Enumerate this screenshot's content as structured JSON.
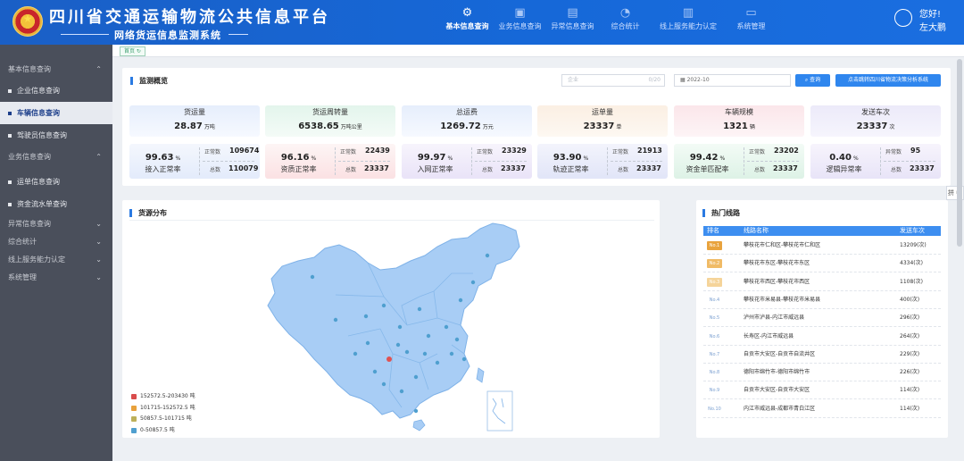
{
  "header": {
    "title": "四川省交通运输物流公共信息平台",
    "subtitle": "网络货运信息监测系统",
    "user_greeting": "您好!",
    "user_name": "左大鹏",
    "nav": [
      {
        "label": "基本信息查询",
        "icon": "grid-icon"
      },
      {
        "label": "业务信息查询",
        "icon": "box-icon"
      },
      {
        "label": "异常信息查询",
        "icon": "document-icon"
      },
      {
        "label": "综合统计",
        "icon": "pie-icon"
      },
      {
        "label": "线上服务能力认定",
        "icon": "building-icon"
      },
      {
        "label": "系统管理",
        "icon": "monitor-icon"
      }
    ]
  },
  "sidebar": {
    "groups": [
      {
        "label": "基本信息查询",
        "expanded": true,
        "items": [
          "企业信息查询",
          "车辆信息查询",
          "驾驶员信息查询"
        ]
      },
      {
        "label": "业务信息查询",
        "expanded": true,
        "items": [
          "运单信息查询",
          "资金流水单查询"
        ]
      },
      {
        "label": "异常信息查询",
        "expanded": false,
        "items": []
      },
      {
        "label": "综合统计",
        "expanded": false,
        "items": []
      },
      {
        "label": "线上服务能力认定",
        "expanded": false,
        "items": []
      },
      {
        "label": "系统管理",
        "expanded": false,
        "items": []
      }
    ],
    "active_item": "车辆信息查询"
  },
  "tab": {
    "label": "首页 ↻"
  },
  "monitor": {
    "title": "监测概览",
    "company_placeholder": "企业",
    "company_count": "0/20",
    "date_value": "2022-10",
    "query_label": "查询",
    "analysis_label": "点击跳转四川省物流决策分析系统",
    "stats": [
      {
        "label": "货运量",
        "value": "28.87",
        "unit": "万吨"
      },
      {
        "label": "货运周转量",
        "value": "6538.65",
        "unit": "万吨公里"
      },
      {
        "label": "总运费",
        "value": "1269.72",
        "unit": "万元"
      },
      {
        "label": "运单量",
        "value": "23337",
        "unit": "单"
      },
      {
        "label": "车辆规模",
        "value": "1321",
        "unit": "辆"
      },
      {
        "label": "发送车次",
        "value": "23337",
        "unit": "次"
      }
    ],
    "rates": [
      {
        "pct": "99.63",
        "label": "接入正常率",
        "k1": "正常数",
        "v1": "109674",
        "k2": "总数",
        "v2": "110079"
      },
      {
        "pct": "96.16",
        "label": "资质正常率",
        "k1": "正常数",
        "v1": "22439",
        "k2": "总数",
        "v2": "23337"
      },
      {
        "pct": "99.97",
        "label": "入网正常率",
        "k1": "正常数",
        "v1": "23329",
        "k2": "总数",
        "v2": "23337"
      },
      {
        "pct": "93.90",
        "label": "轨迹正常率",
        "k1": "正常数",
        "v1": "21913",
        "k2": "总数",
        "v2": "23337"
      },
      {
        "pct": "99.42",
        "label": "资金单匹配率",
        "k1": "正常数",
        "v1": "23202",
        "k2": "总数",
        "v2": "23337"
      },
      {
        "pct": "0.40",
        "label": "逻辑异常率",
        "k1": "异常数",
        "v1": "95",
        "k2": "总数",
        "v2": "23337"
      }
    ],
    "pct_unit": "%"
  },
  "source": {
    "title": "货源分布",
    "legend": [
      {
        "label": "152572.5-203430 吨",
        "color": "#d94c4c"
      },
      {
        "label": "101715-152572.5 吨",
        "color": "#e8a13c"
      },
      {
        "label": "50857.5-101715 吨",
        "color": "#bdb05a"
      },
      {
        "label": "0-50857.5 吨",
        "color": "#4f9fcf"
      }
    ]
  },
  "hot_routes": {
    "title": "热门线路",
    "col_rank": "排名",
    "col_name": "线路名称",
    "col_count": "发送车次",
    "rows": [
      {
        "rank": "No.1",
        "name": "攀枝花市仁和区-攀枝花市仁和区",
        "count": "13209(次)"
      },
      {
        "rank": "No.2",
        "name": "攀枝花市东区-攀枝花市东区",
        "count": "4334(次)"
      },
      {
        "rank": "No.3",
        "name": "攀枝花市西区-攀枝花市西区",
        "count": "1108(次)"
      },
      {
        "rank": "No.4",
        "name": "攀枝花市米易县-攀枝花市米易县",
        "count": "400(次)"
      },
      {
        "rank": "No.5",
        "name": "泸州市泸县-内江市威远县",
        "count": "296(次)"
      },
      {
        "rank": "No.6",
        "name": "长寿区-内江市威远县",
        "count": "264(次)"
      },
      {
        "rank": "No.7",
        "name": "自贡市大安区-自贡市自流井区",
        "count": "229(次)"
      },
      {
        "rank": "No.8",
        "name": "德阳市绵竹市-德阳市绵竹市",
        "count": "226(次)"
      },
      {
        "rank": "No.9",
        "name": "自贡市大安区-自贡市大安区",
        "count": "114(次)"
      },
      {
        "rank": "No.10",
        "name": "内江市威远县-成都市青白江区",
        "count": "114(次)"
      }
    ],
    "rank_colors": [
      "#e9a33d",
      "#f0bb66",
      "#f5d49a"
    ]
  },
  "feedback": {
    "label": "拼 中"
  }
}
